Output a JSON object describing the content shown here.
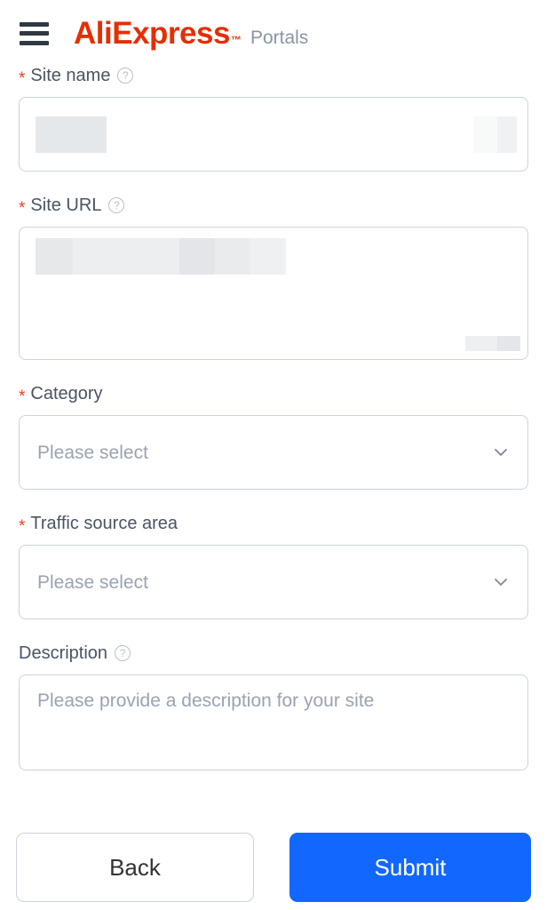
{
  "header": {
    "menu_icon": "hamburger-menu-icon",
    "logo_text": "AliExpress",
    "logo_tm": "™",
    "logo_color": "#e62e04",
    "sub_brand": "Portals",
    "sub_brand_color": "#8b95a3"
  },
  "form": {
    "required_marker": "*",
    "help_glyph": "?",
    "fields": [
      {
        "id": "site-name",
        "label": "Site name",
        "required": true,
        "has_help": true,
        "value": "",
        "placeholder": ""
      },
      {
        "id": "site-url",
        "label": "Site URL",
        "required": true,
        "has_help": true,
        "value": "",
        "placeholder": ""
      },
      {
        "id": "category",
        "label": "Category",
        "required": true,
        "has_help": false,
        "value": "",
        "placeholder": "Please select"
      },
      {
        "id": "traffic-source-area",
        "label": "Traffic source area",
        "required": true,
        "has_help": false,
        "value": "",
        "placeholder": "Please select"
      },
      {
        "id": "description",
        "label": "Description",
        "required": false,
        "has_help": true,
        "value": "",
        "placeholder": "Please provide a description for your site"
      }
    ]
  },
  "actions": {
    "back_label": "Back",
    "submit_label": "Submit",
    "submit_color": "#1267ff"
  }
}
